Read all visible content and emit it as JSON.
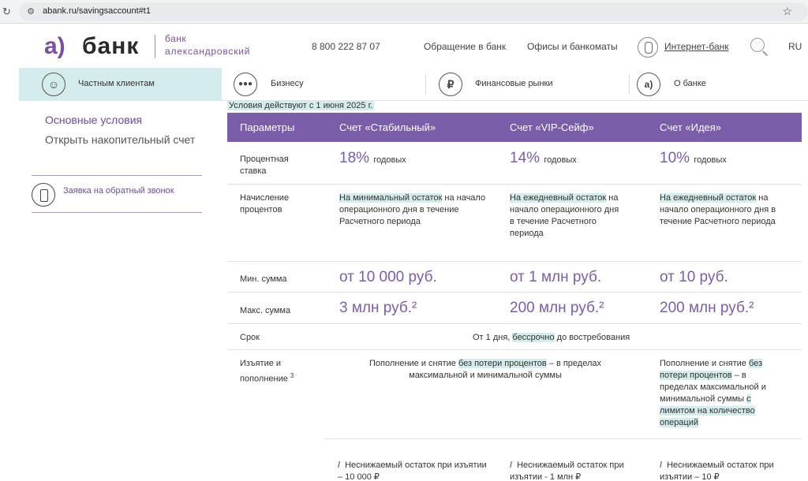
{
  "browser": {
    "url": "abank.ru/savingsaccount#t1"
  },
  "header": {
    "logo_mark": "а)",
    "logo_word": "банк",
    "logo_sub1": "банк",
    "logo_sub2": "александровский",
    "phone": "8 800 222 87 07",
    "nav": [
      "Обращение в банк",
      "Офисы и банкоматы"
    ],
    "internet_bank": "Интернет-банк",
    "lang": "RU"
  },
  "categories": [
    {
      "label": "Частным клиентам",
      "icon": "person-icon",
      "active": true
    },
    {
      "label": "Бизнесу",
      "icon": "group-icon",
      "active": false
    },
    {
      "label": "Финансовые рынки",
      "icon": "ruble-icon",
      "active": false
    },
    {
      "label": "О банке",
      "icon": "bank-logo-icon",
      "active": false
    }
  ],
  "sidebar": {
    "main": "Основные условия",
    "open": "Открыть накопительный счет",
    "callback": "Заявка на обратный звонок"
  },
  "table": {
    "note": "Условия действуют с 1 июня 2025 г.",
    "headers": [
      "Параметры",
      "Счет «Стабильный»",
      "Счет «VIP-Сейф»",
      "Счет «Идея»"
    ],
    "rate_label": "Процентная ставка",
    "rates": [
      {
        "value": "18%",
        "unit": "годовых"
      },
      {
        "value": "14%",
        "unit": "годовых"
      },
      {
        "value": "10%",
        "unit": "годовых"
      }
    ],
    "accrual_label": "Начисление процентов",
    "accrual": [
      {
        "hl": "На минимальный остаток",
        "rest": " на начало операционного дня в течение Расчетного периода"
      },
      {
        "hl": "На ежедневный остаток",
        "rest": " на начало операционного дня в течение Расчетного периода"
      },
      {
        "hl": "На ежедневный остаток",
        "rest": " на начало операционного дня в течение Расчетного периода"
      }
    ],
    "min_label": "Мин. сумма",
    "min": [
      "от 10 000 руб.",
      "от 1 млн руб.",
      "от 10 руб."
    ],
    "max_label": "Макс. сумма",
    "max": [
      "3 млн руб.²",
      "200 млн руб.²",
      "200 млн руб.²"
    ],
    "term_label": "Срок",
    "term_pre": "От 1 дня, ",
    "term_hl": "бессрочно",
    "term_post": " до востребования",
    "withdraw_label": "Изъятие и пополнение",
    "withdraw_sup": "3",
    "withdraw_common_pre": "Пополнение и снятие ",
    "withdraw_common_hl": "без потери процентов",
    "withdraw_common_post": " – в пределах максимальной и минимальной суммы",
    "withdraw_idea_pre": "Пополнение и снятие ",
    "withdraw_idea_hl": "без потери процентов",
    "withdraw_idea_mid": " – в пределах максимальной и минимальной суммы ",
    "withdraw_idea_hl2": "с лимитом на количество операций",
    "bullets": [
      "Неснижаемый остаток при изъятии – 10 000 ₽",
      "Неснижаемый остаток при изъятии - 1 млн ₽",
      "Неснижаемый остаток при изъятии – 10 ₽"
    ]
  }
}
